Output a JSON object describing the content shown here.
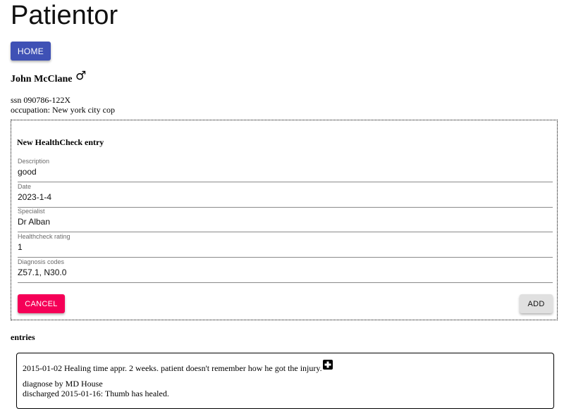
{
  "app": {
    "title": "Patientor"
  },
  "nav": {
    "home_label": "HOME"
  },
  "patient": {
    "name": "John McClane",
    "gender_icon": "male-icon",
    "ssn_line": "ssn 090786-122X",
    "occupation_line": "occupation: New york city cop"
  },
  "form": {
    "title": "New HealthCheck entry",
    "fields": [
      {
        "label": "Description",
        "value": "good"
      },
      {
        "label": "Date",
        "value": "2023-1-4"
      },
      {
        "label": "Specialist",
        "value": "Dr Alban"
      },
      {
        "label": "Healthcheck rating",
        "value": "1"
      },
      {
        "label": "Diagnosis codes",
        "value": "Z57.1, N30.0"
      }
    ],
    "cancel_label": "CANCEL",
    "add_label": "ADD"
  },
  "entries": {
    "heading": "entries",
    "items": [
      {
        "description": "2015-01-02 Healing time appr. 2 weeks. patient doesn't remember how he got the injury.",
        "type_icon": "hospital-icon",
        "diagnose_line": "diagnose by MD House",
        "discharge_line": "discharged 2015-01-16: Thumb has healed."
      }
    ]
  },
  "colors": {
    "primary": "#3f51b5",
    "secondary": "#f50057",
    "default_button": "#e0e0e0"
  }
}
